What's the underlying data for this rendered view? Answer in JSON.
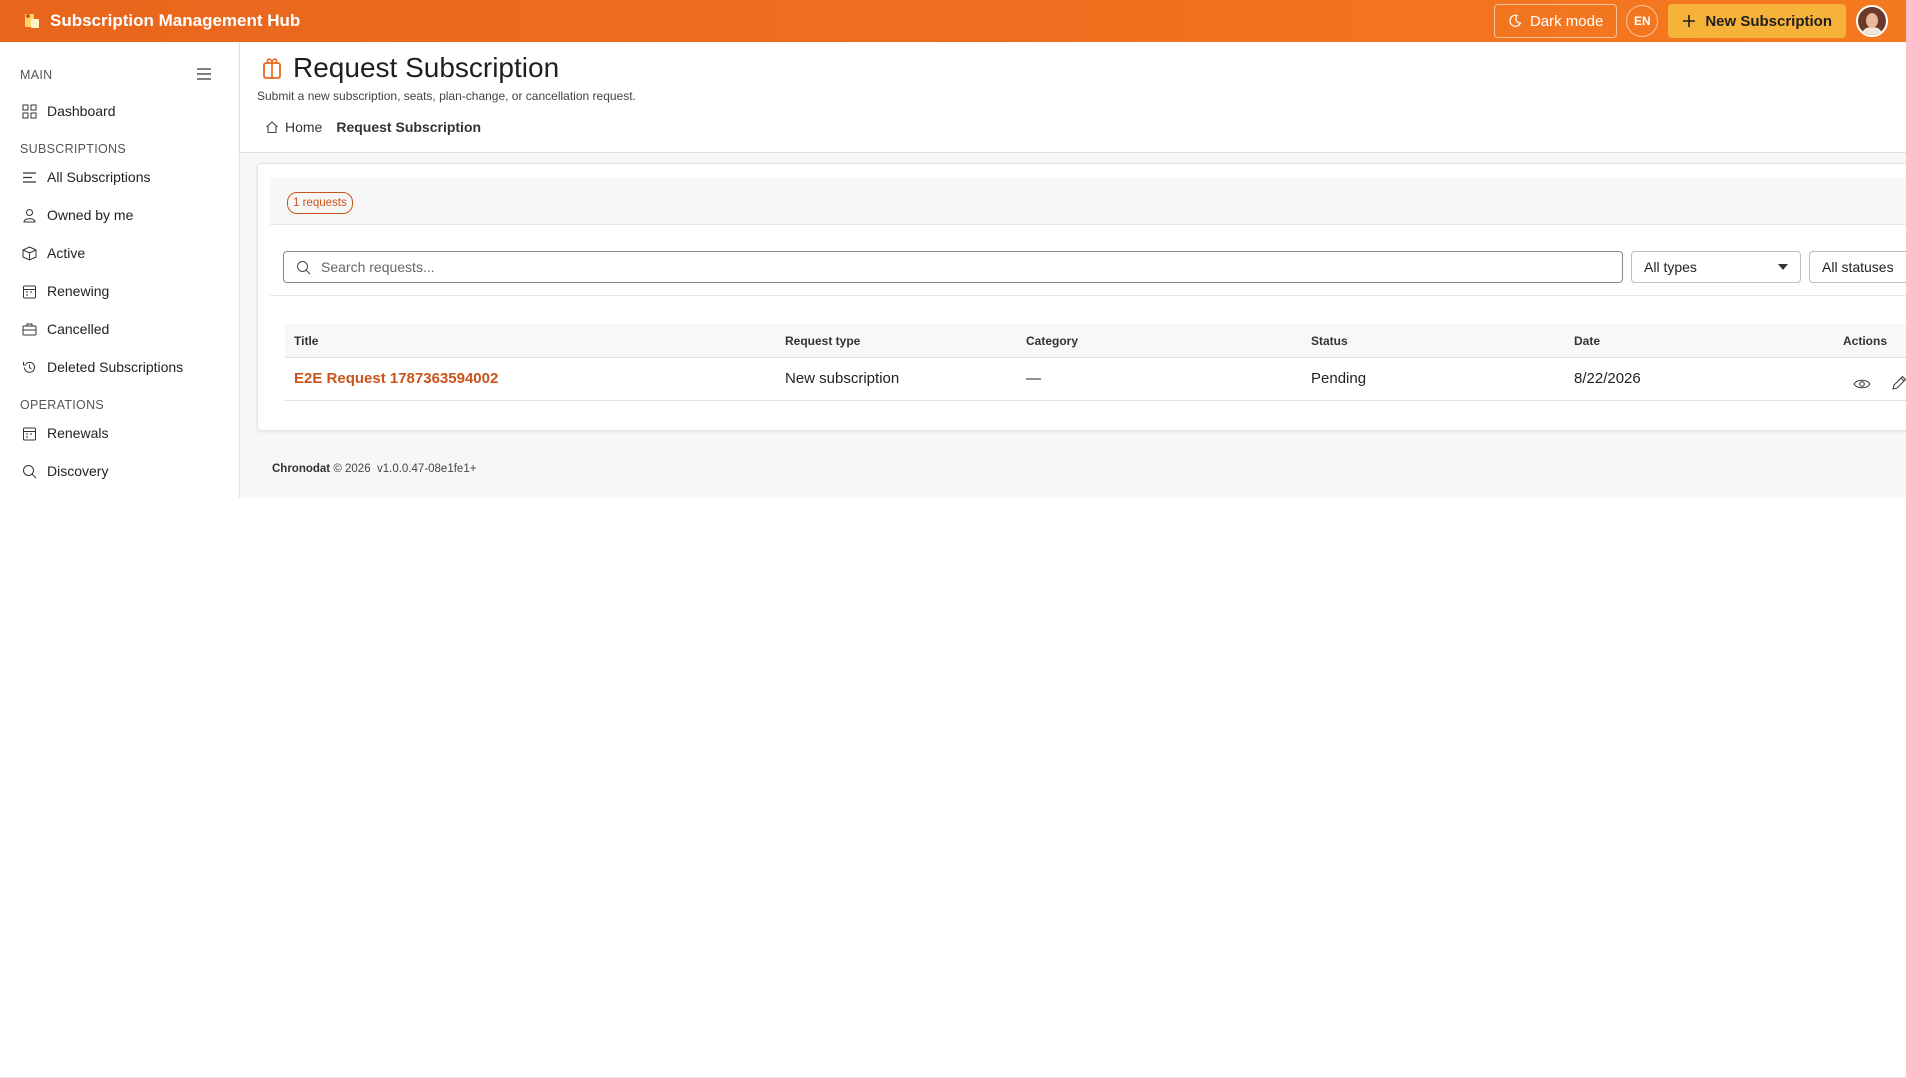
{
  "app": {
    "title": "Subscription Management Hub"
  },
  "topbar": {
    "dark_mode_label": "Dark mode",
    "language": "EN",
    "new_subscription_label": "New Subscription"
  },
  "sidebar": {
    "sections": [
      {
        "title": "MAIN"
      },
      {
        "title": "SUBSCRIPTIONS"
      },
      {
        "title": "OPERATIONS"
      }
    ],
    "items": [
      {
        "label": "Dashboard",
        "icon": "grid-icon"
      },
      {
        "label": "All Subscriptions",
        "icon": "list-icon"
      },
      {
        "label": "Owned by me",
        "icon": "person-icon"
      },
      {
        "label": "Active",
        "icon": "box-icon"
      },
      {
        "label": "Renewing",
        "icon": "calendar-icon"
      },
      {
        "label": "Cancelled",
        "icon": "briefcase-icon"
      },
      {
        "label": "Deleted Subscriptions",
        "icon": "history-icon"
      },
      {
        "label": "Renewals",
        "icon": "calendar-icon"
      },
      {
        "label": "Discovery",
        "icon": "search-icon"
      }
    ]
  },
  "page": {
    "title": "Request Subscription",
    "subtitle": "Submit a new subscription, seats, plan-change, or cancellation request.",
    "breadcrumb": {
      "home": "Home",
      "current": "Request Subscription"
    }
  },
  "requests": {
    "count_label": "1 requests",
    "search_placeholder": "Search requests...",
    "type_filter": "All types",
    "status_filter": "All statuses",
    "columns": [
      "Title",
      "Request type",
      "Category",
      "Status",
      "Date",
      "Actions"
    ],
    "rows": [
      {
        "title": "E2E Request 1787363594002",
        "request_type": "New subscription",
        "category": "—",
        "status": "Pending",
        "date": "8/22/2026"
      }
    ]
  },
  "footer": {
    "brand": "Chronodat",
    "copyright": "© 2026",
    "version": "v1.0.0.47-08e1fe1+"
  },
  "colors": {
    "accent": "#f07020",
    "link": "#c8541a",
    "new_button": "#f7b23a"
  }
}
